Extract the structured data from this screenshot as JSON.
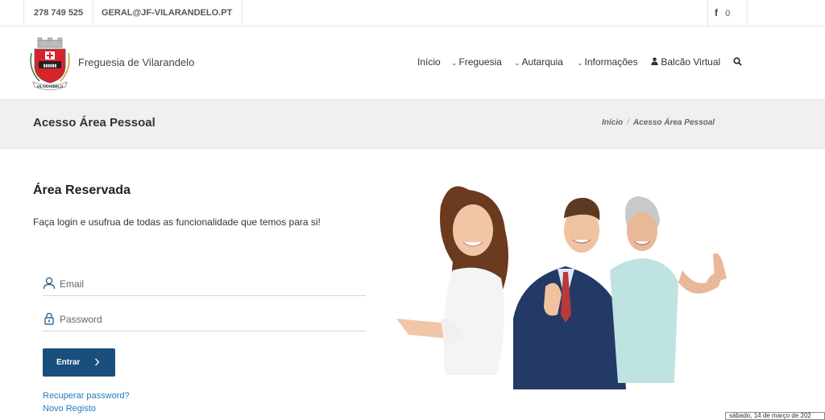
{
  "topbar": {
    "phone": "278 749 525",
    "email": "GERAL@JF-VILARANDELO.PT",
    "facebook_icon": "facebook-icon",
    "likes_count": "0",
    "like_icon": "thumbs-up-icon"
  },
  "header": {
    "site_name": "Freguesia de Vilarandelo",
    "logo_text": "VILARANDELO",
    "nav": [
      {
        "label": "Início",
        "chevron": false
      },
      {
        "label": "Freguesia",
        "chevron": true
      },
      {
        "label": "Autarquia",
        "chevron": true
      },
      {
        "label": "Informações",
        "chevron": true
      },
      {
        "label": "Balcão Virtual",
        "icon": "user-icon"
      }
    ],
    "search_icon": "search-icon"
  },
  "band": {
    "title": "Acesso Área Pessoal",
    "breadcrumbs": [
      "Início",
      "Acesso Área Pessoal"
    ]
  },
  "main": {
    "section_title": "Área Reservada",
    "intro": "Faça login e usufrua de todas as funcionalidade que temos para si!",
    "email_placeholder": "Email",
    "password_placeholder": "Password",
    "submit_label": "Entrar",
    "recover_link": "Recuperar password?",
    "register_link": "Novo Registo"
  },
  "footer": {
    "date": "sábado, 14 de março de 202"
  },
  "colors": {
    "button": "#1a4f7d",
    "link": "#1f7bbf",
    "band": "#f0f0f0"
  }
}
